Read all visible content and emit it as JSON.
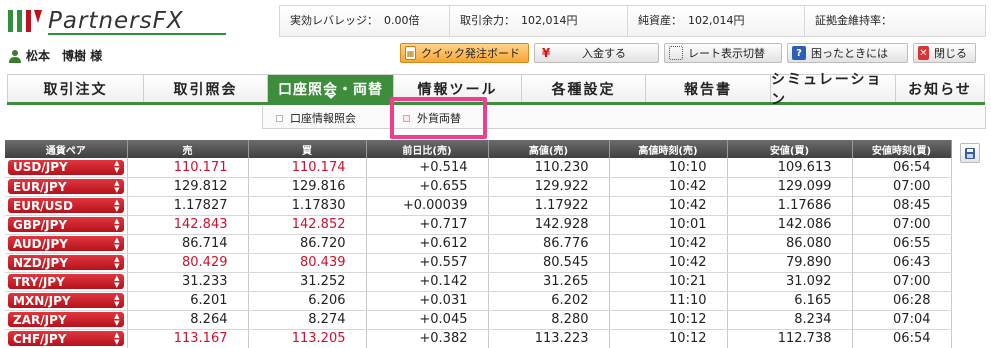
{
  "brand": {
    "name": "PartnersFX"
  },
  "account_info": {
    "leverage_label": "実効レバレッジ：",
    "leverage_value": "0.00倍",
    "margin_label": "取引余力：",
    "margin_value": "102,014円",
    "equity_label": "純資産：",
    "equity_value": "102,014円",
    "maintenance_label": "証拠金維持率：",
    "maintenance_value": ""
  },
  "user": {
    "name": "松本　博樹 様"
  },
  "toolbar": {
    "quick_order": "クイック発注ボード",
    "deposit": "入金する",
    "rate_toggle": "レート表示切替",
    "help": "困ったときには",
    "close": "閉じる"
  },
  "nav": {
    "items": [
      {
        "label": "取引注文"
      },
      {
        "label": "取引照会"
      },
      {
        "label": "口座照会・両替"
      },
      {
        "label": "情報ツール"
      },
      {
        "label": "各種設定"
      },
      {
        "label": "報告書"
      },
      {
        "label": "シミュレーション"
      },
      {
        "label": "お知らせ"
      }
    ],
    "active_index": 2
  },
  "subnav": {
    "items": [
      {
        "label": "口座情報照会"
      },
      {
        "label": "外貨両替"
      }
    ],
    "highlighted_index": 1
  },
  "rate_table": {
    "headers": [
      "通貨ペア",
      "売",
      "買",
      "前日比(売)",
      "高値(売)",
      "高値時刻(売)",
      "安値(買)",
      "安値時刻(買)"
    ],
    "rows": [
      {
        "pair": "USD/JPY",
        "sell": "110.171",
        "buy": "110.174",
        "change": "+0.514",
        "high": "110.230",
        "high_time": "10:10",
        "low": "109.613",
        "low_time": "06:54",
        "red": true
      },
      {
        "pair": "EUR/JPY",
        "sell": "129.812",
        "buy": "129.816",
        "change": "+0.655",
        "high": "129.922",
        "high_time": "10:42",
        "low": "129.099",
        "low_time": "07:00",
        "red": false
      },
      {
        "pair": "EUR/USD",
        "sell": "1.17827",
        "buy": "1.17830",
        "change": "+0.00039",
        "high": "1.17922",
        "high_time": "10:42",
        "low": "1.17686",
        "low_time": "08:45",
        "red": false
      },
      {
        "pair": "GBP/JPY",
        "sell": "142.843",
        "buy": "142.852",
        "change": "+0.717",
        "high": "142.928",
        "high_time": "10:01",
        "low": "142.086",
        "low_time": "07:00",
        "red": true
      },
      {
        "pair": "AUD/JPY",
        "sell": "86.714",
        "buy": "86.720",
        "change": "+0.612",
        "high": "86.776",
        "high_time": "10:42",
        "low": "86.080",
        "low_time": "06:55",
        "red": false
      },
      {
        "pair": "NZD/JPY",
        "sell": "80.429",
        "buy": "80.439",
        "change": "+0.557",
        "high": "80.545",
        "high_time": "10:42",
        "low": "79.890",
        "low_time": "06:43",
        "red": true
      },
      {
        "pair": "TRY/JPY",
        "sell": "31.233",
        "buy": "31.252",
        "change": "+0.142",
        "high": "31.265",
        "high_time": "10:21",
        "low": "31.092",
        "low_time": "07:00",
        "red": false
      },
      {
        "pair": "MXN/JPY",
        "sell": "6.201",
        "buy": "6.206",
        "change": "+0.031",
        "high": "6.202",
        "high_time": "11:10",
        "low": "6.165",
        "low_time": "06:28",
        "red": false
      },
      {
        "pair": "ZAR/JPY",
        "sell": "8.264",
        "buy": "8.274",
        "change": "+0.045",
        "high": "8.280",
        "high_time": "10:12",
        "low": "8.234",
        "low_time": "07:04",
        "red": false
      },
      {
        "pair": "CHF/JPY",
        "sell": "113.167",
        "buy": "113.205",
        "change": "+0.382",
        "high": "113.223",
        "high_time": "10:12",
        "low": "112.738",
        "low_time": "06:54",
        "red": true
      }
    ]
  },
  "colors": {
    "nav_active": "#3d8d3d",
    "pair_button": "#c81e28",
    "highlight": "#ee3f8d",
    "price_red": "#d0102b"
  },
  "icons": {
    "save": "save-icon",
    "user": "user-icon"
  }
}
